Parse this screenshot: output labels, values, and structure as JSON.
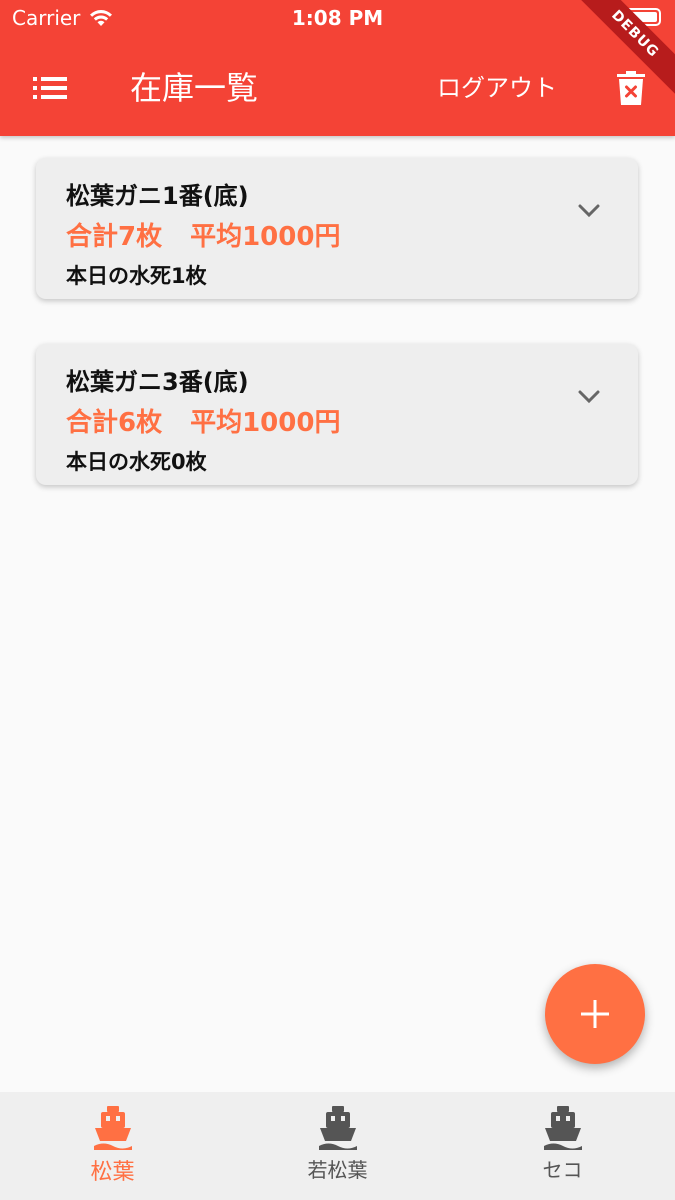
{
  "colors": {
    "appbar": "#f44336",
    "accent": "#ff7043",
    "nav_inactive": "#555555",
    "background": "#fafafa",
    "card": "#eeeeee"
  },
  "status_bar": {
    "carrier": "Carrier",
    "time": "1:08 PM"
  },
  "debug_banner": "DEBUG",
  "app_bar": {
    "menu_icon": "list-icon",
    "title": "在庫一覧",
    "logout_label": "ログアウト",
    "delete_icon": "delete-forever-icon"
  },
  "items": [
    {
      "name": "松葉ガニ1番(底)",
      "total": "合計7枚",
      "average": "平均1000円",
      "dead_today": "本日の水死1枚"
    },
    {
      "name": "松葉ガニ3番(底)",
      "total": "合計6枚",
      "average": "平均1000円",
      "dead_today": "本日の水死0枚"
    }
  ],
  "fab": {
    "icon": "plus-icon"
  },
  "bottom_nav": {
    "items": [
      {
        "label": "松葉",
        "icon": "ship-icon",
        "active": true
      },
      {
        "label": "若松葉",
        "icon": "ship-icon",
        "active": false
      },
      {
        "label": "セコ",
        "icon": "ship-icon",
        "active": false
      }
    ]
  }
}
